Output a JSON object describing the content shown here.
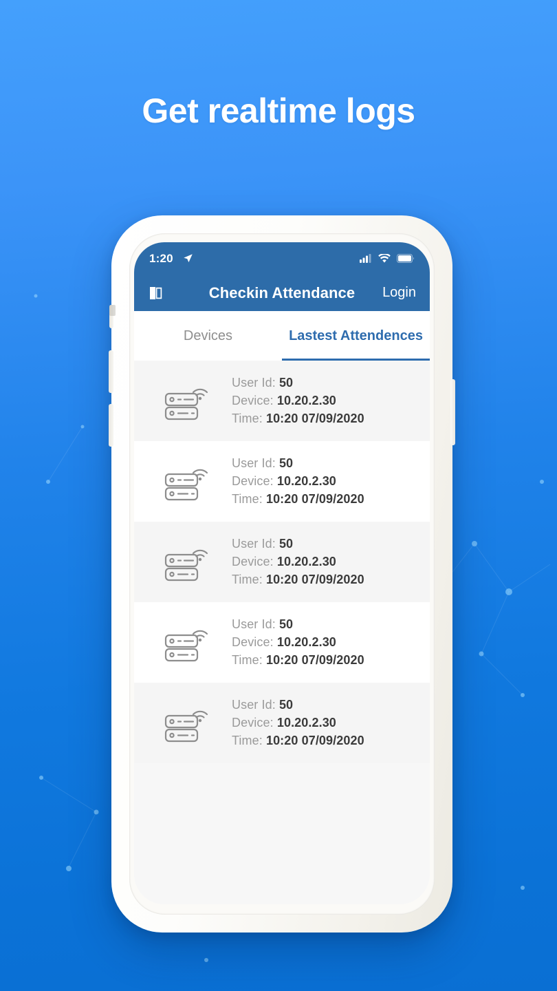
{
  "headline": "Get realtime logs",
  "theme": {
    "bg_top": "#44a0fc",
    "bg_bottom": "#0a6fd3",
    "appbar": "#2d6ca9",
    "accent": "#2e6cae",
    "row_alt": "#f5f5f5",
    "row_base": "#ffffff"
  },
  "phone": {
    "statusbar": {
      "time": "1:20",
      "location_icon": "location-arrow-icon",
      "signal_icon": "cellular-signal-icon",
      "wifi_icon": "wifi-icon",
      "battery_icon": "battery-full-icon"
    },
    "appbar": {
      "menu_icon": "open-book-icon",
      "title": "Checkin Attendance",
      "login_label": "Login"
    },
    "tabs": [
      {
        "label": "Devices",
        "active": false
      },
      {
        "label": "Lastest Attendences",
        "active": true
      }
    ],
    "list": {
      "labels": {
        "user_id": "User Id:",
        "device": "Device:",
        "time": "Time:"
      },
      "rows": [
        {
          "icon": "server-wifi-icon",
          "user_id": "50",
          "device": "10.20.2.30",
          "time": "10:20 07/09/2020"
        },
        {
          "icon": "server-wifi-icon",
          "user_id": "50",
          "device": "10.20.2.30",
          "time": "10:20 07/09/2020"
        },
        {
          "icon": "server-wifi-icon",
          "user_id": "50",
          "device": "10.20.2.30",
          "time": "10:20 07/09/2020"
        },
        {
          "icon": "server-wifi-icon",
          "user_id": "50",
          "device": "10.20.2.30",
          "time": "10:20 07/09/2020"
        },
        {
          "icon": "server-wifi-icon",
          "user_id": "50",
          "device": "10.20.2.30",
          "time": "10:20 07/09/2020"
        }
      ]
    }
  }
}
